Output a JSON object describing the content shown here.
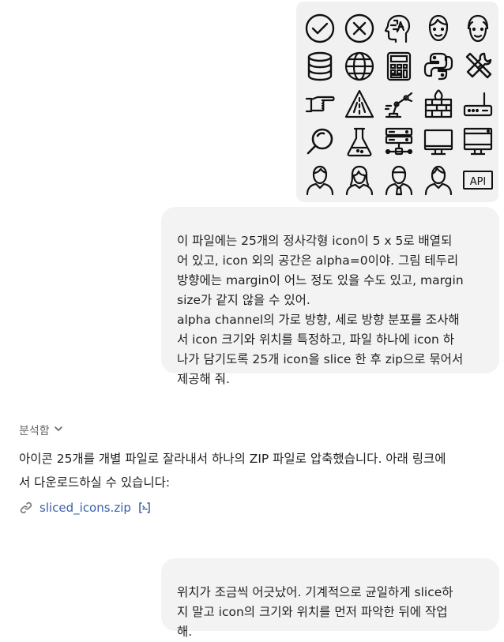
{
  "uploaded_image": {
    "icons": [
      "check-circle-icon",
      "x-circle-icon",
      "ai-head-icon",
      "man-face-icon",
      "bald-man-face-icon",
      "database-icon",
      "globe-icon",
      "calculator-icon",
      "python-logo-icon",
      "tools-icon",
      "pointing-hand-icon",
      "road-warning-icon",
      "robot-arm-icon",
      "firewall-icon",
      "router-icon",
      "magnifier-icon",
      "flask-icon",
      "server-network-icon",
      "monitor-icon",
      "desktop-computer-icon",
      "man-avatar-icon",
      "woman-avatar-icon",
      "man-tie-avatar-icon",
      "man-avatar-2-icon",
      "api-box-icon"
    ],
    "api_label": "API"
  },
  "messages": {
    "user_1": "이 파일에는 25개의 정사각형 icon이 5 x 5로 배열되\n어 있고, icon 외의 공간은 alpha=0이야. 그림 테두리\n방향에는 margin이 어느 정도 있을 수도 있고, margin\nsize가 같지 않을 수 있어.\nalpha channel의 가로 방향, 세로 방향 분포를 조사해\n서 icon 크기와 위치를 특정하고, 파일 하나에 icon 하\n나가 담기도록 25개 icon을 slice 한 후 zip으로 묶어서\n제공해 줘.",
    "analysis_label": "분석함",
    "assistant_1": "아이콘 25개를 개별 파일로 잘라내서 하나의 ZIP 파일로 압축했습니다. 아래 링크에\n서 다운로드하실 수 있습니다:",
    "file_name": "sliced_icons.zip",
    "user_2": "위치가 조금씩 어긋났어. 기계적으로 균일하게 slice하\n지 말고 icon의 크기와 위치를 먼저 파악한 뒤에 작업\n해."
  },
  "colors": {
    "bubble": "#f3f3f3",
    "link": "#3a5fa8",
    "muted": "#666666"
  }
}
